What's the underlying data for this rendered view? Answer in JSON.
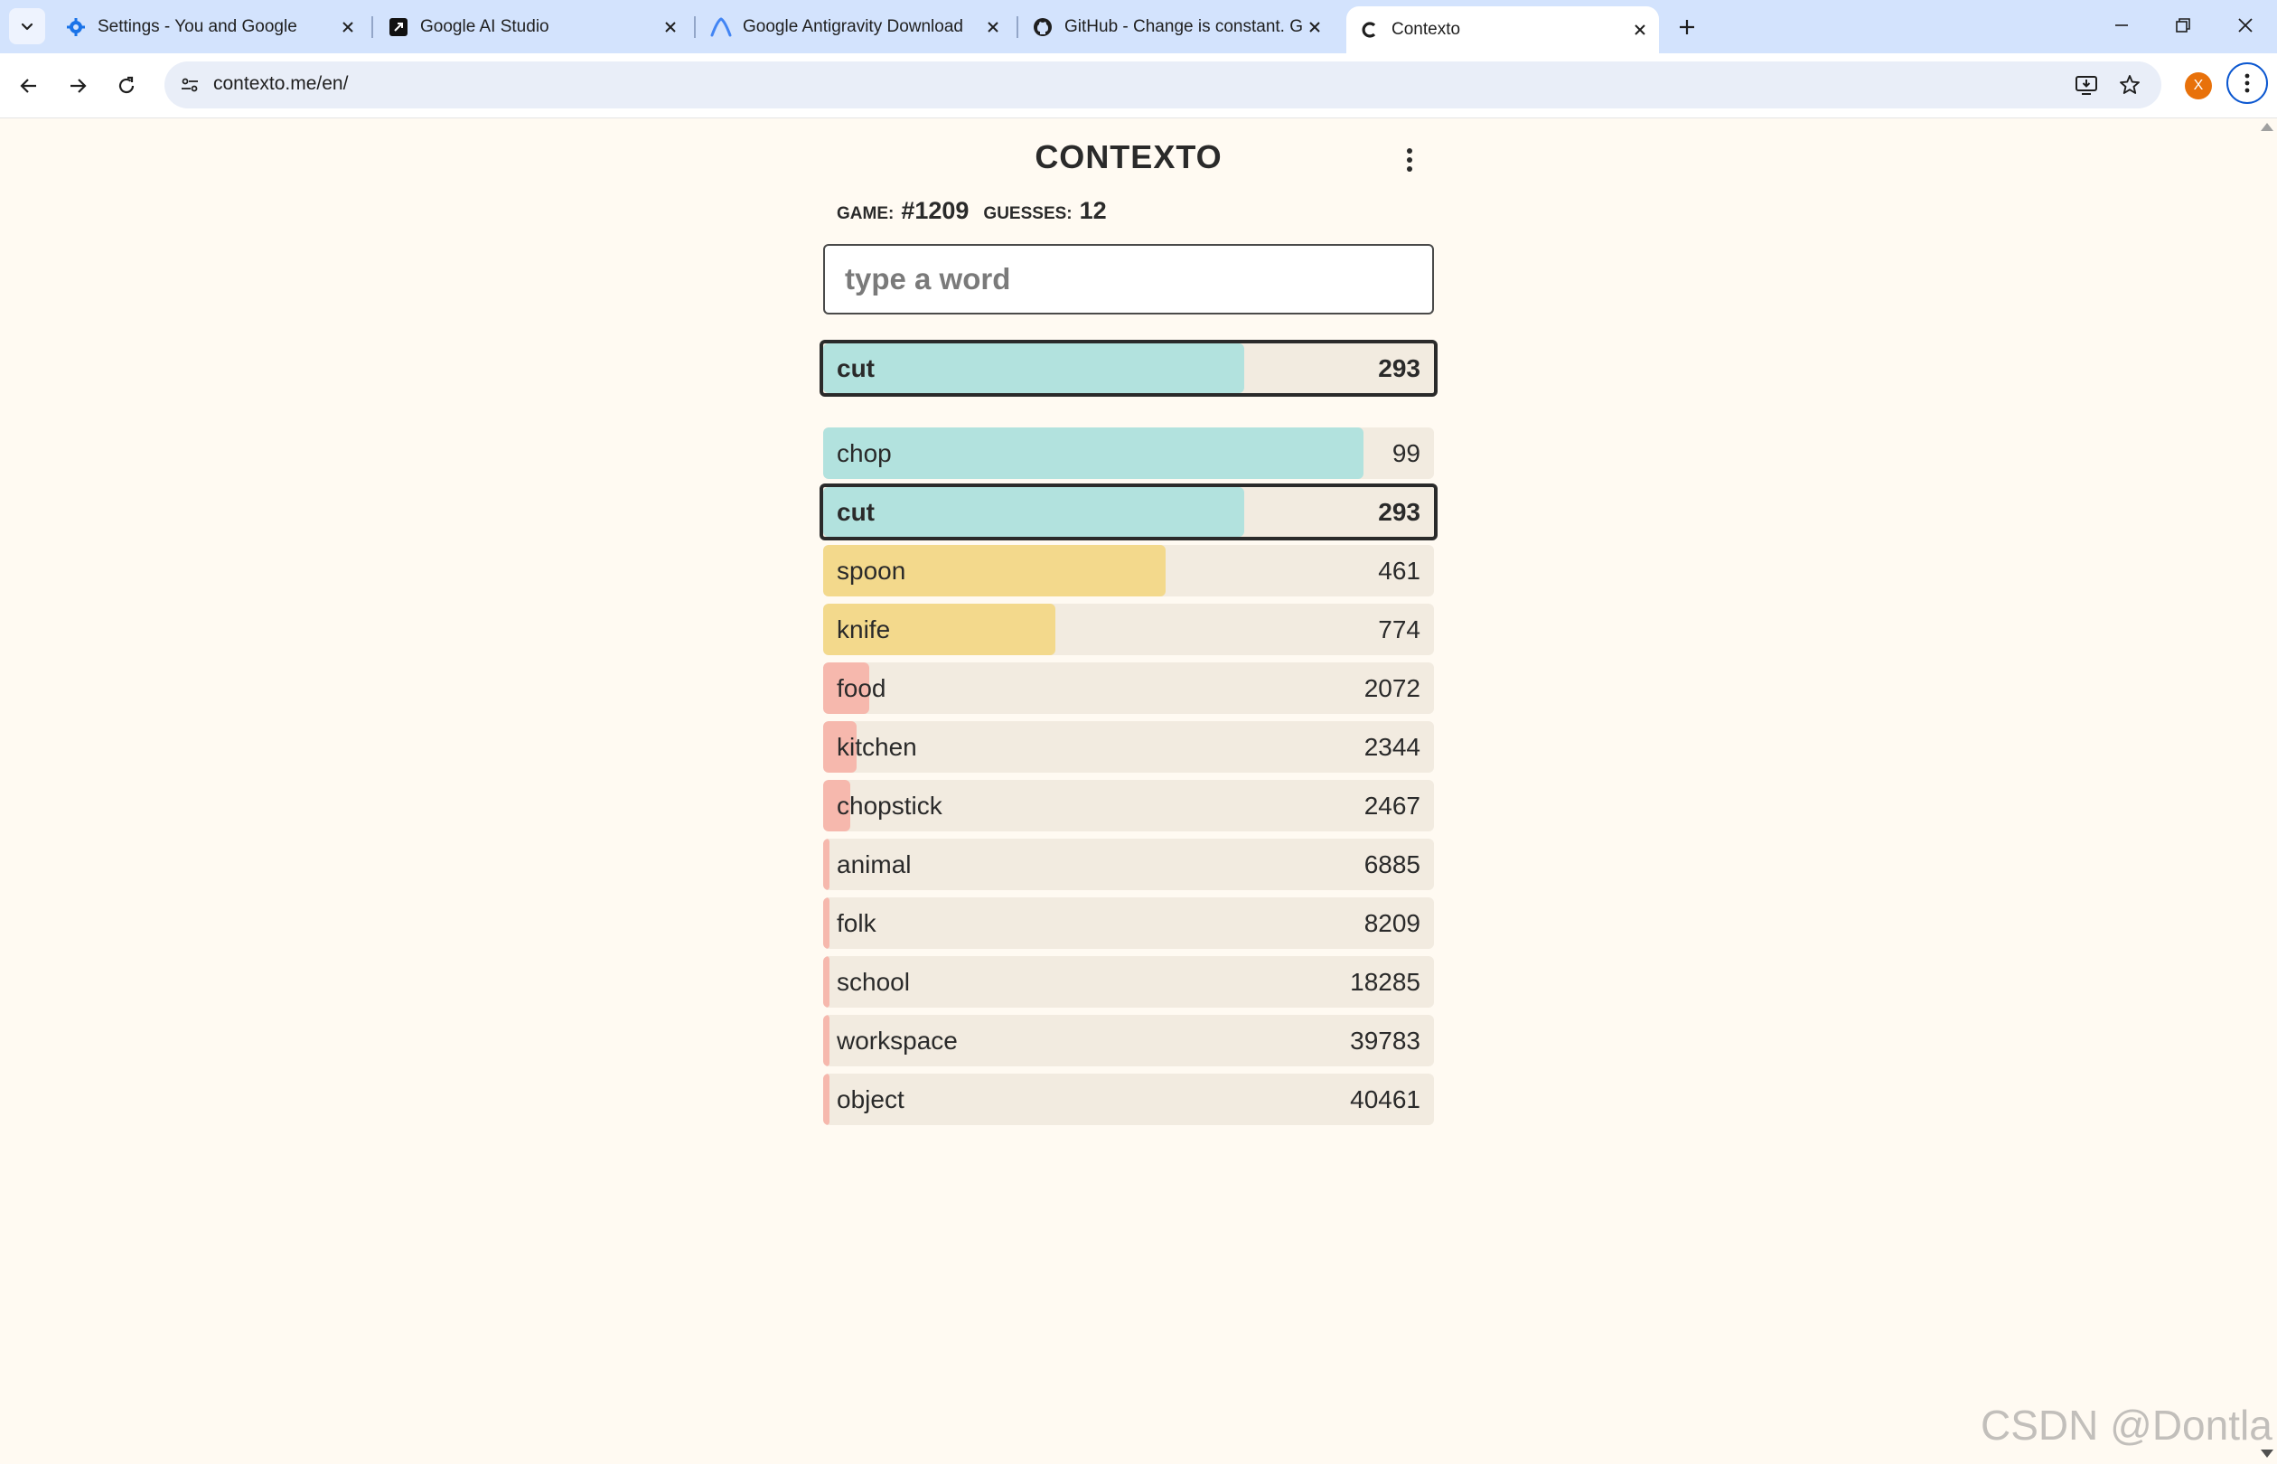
{
  "browser": {
    "tabs": [
      {
        "title": "Settings - You and Google",
        "icon": "gear-icon"
      },
      {
        "title": "Google AI Studio",
        "icon": "ai-studio-icon"
      },
      {
        "title": "Google Antigravity Download",
        "icon": "antigravity-icon"
      },
      {
        "title": "GitHub - Change is constant. Gi",
        "icon": "github-icon"
      },
      {
        "title": "Contexto",
        "icon": "contexto-icon",
        "active": true
      }
    ],
    "url": "contexto.me/en/",
    "profile_initial": "X"
  },
  "game": {
    "title": "CONTEXTO",
    "game_label": "GAME:",
    "game_number": "#1209",
    "guesses_label": "GUESSES:",
    "guesses_count": "12",
    "input_placeholder": "type a word",
    "colors": {
      "close": "#b2e2de",
      "mid": "#f3d98c",
      "far": "#f6b8ad",
      "row_bg": "#f2ebe0"
    },
    "last_guess": {
      "word": "cut",
      "distance": "293",
      "fill": 0.69,
      "tier": "close"
    },
    "guesses": [
      {
        "word": "chop",
        "distance": "99",
        "fill": 0.885,
        "tier": "close"
      },
      {
        "word": "cut",
        "distance": "293",
        "fill": 0.69,
        "tier": "close",
        "current": true
      },
      {
        "word": "spoon",
        "distance": "461",
        "fill": 0.56,
        "tier": "mid"
      },
      {
        "word": "knife",
        "distance": "774",
        "fill": 0.38,
        "tier": "mid"
      },
      {
        "word": "food",
        "distance": "2072",
        "fill": 0.075,
        "tier": "far"
      },
      {
        "word": "kitchen",
        "distance": "2344",
        "fill": 0.055,
        "tier": "far"
      },
      {
        "word": "chopstick",
        "distance": "2467",
        "fill": 0.045,
        "tier": "far"
      },
      {
        "word": "animal",
        "distance": "6885",
        "fill": 0.01,
        "tier": "far"
      },
      {
        "word": "folk",
        "distance": "8209",
        "fill": 0.01,
        "tier": "far"
      },
      {
        "word": "school",
        "distance": "18285",
        "fill": 0.01,
        "tier": "far"
      },
      {
        "word": "workspace",
        "distance": "39783",
        "fill": 0.01,
        "tier": "far"
      },
      {
        "word": "object",
        "distance": "40461",
        "fill": 0.01,
        "tier": "far"
      }
    ]
  },
  "watermark": "CSDN @Dontla"
}
